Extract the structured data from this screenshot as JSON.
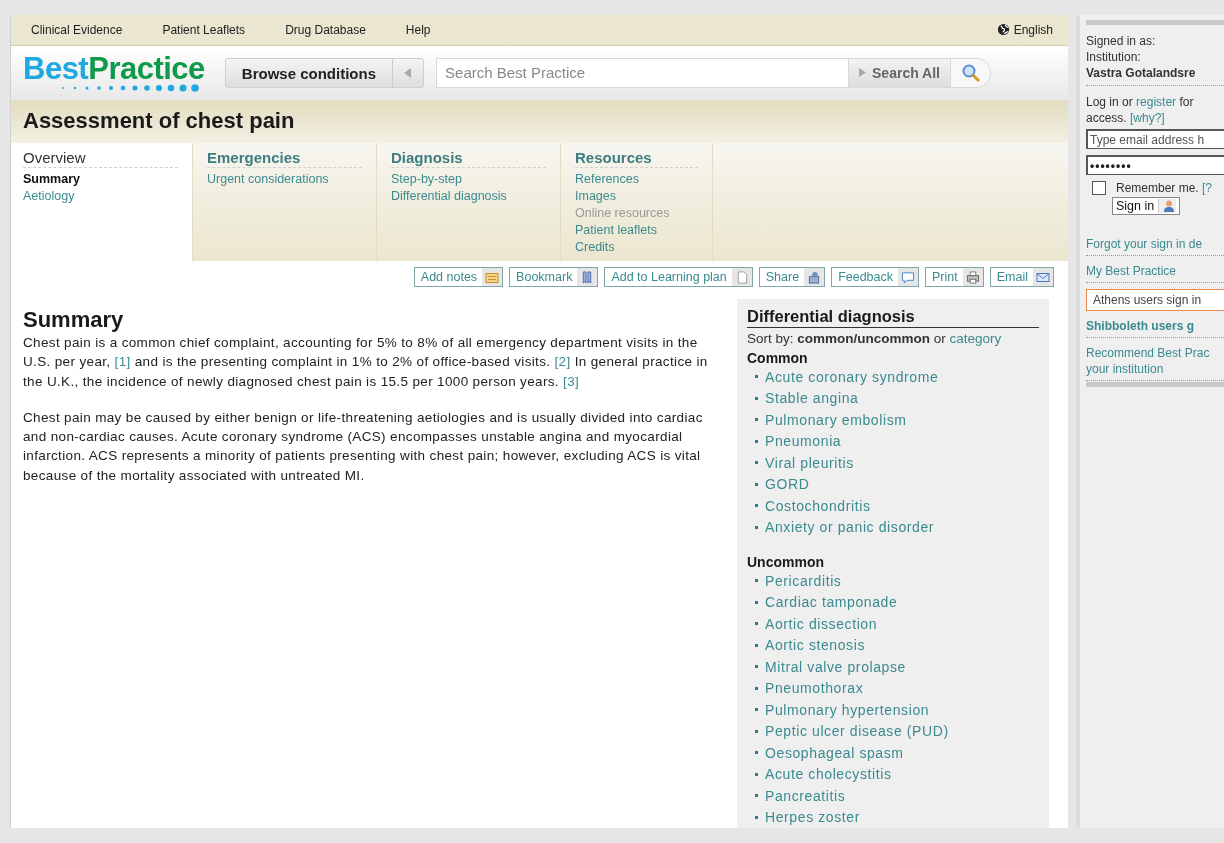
{
  "top_nav": {
    "links": [
      "Clinical Evidence",
      "Patient Leaflets",
      "Drug Database",
      "Help"
    ],
    "language": "English"
  },
  "header": {
    "logo": {
      "first": "Best",
      "second": "Practice"
    },
    "browse_button": "Browse conditions",
    "search": {
      "placeholder": "Search Best Practice"
    },
    "search_all_button": "Search All"
  },
  "page_title": "Assessment of chest pain",
  "tabs": [
    {
      "title": "Overview",
      "selected": true,
      "items": [
        {
          "label": "Summary",
          "selected": true,
          "disabled": false
        },
        {
          "label": "Aetiology",
          "selected": false,
          "disabled": false
        }
      ]
    },
    {
      "title": "Emergencies",
      "selected": false,
      "items": [
        {
          "label": "Urgent considerations",
          "selected": false,
          "disabled": false
        }
      ]
    },
    {
      "title": "Diagnosis",
      "selected": false,
      "items": [
        {
          "label": "Step-by-step",
          "selected": false,
          "disabled": false
        },
        {
          "label": "Differential diagnosis",
          "selected": false,
          "disabled": false
        }
      ]
    },
    {
      "title": "Resources",
      "selected": false,
      "items": [
        {
          "label": "References",
          "selected": false,
          "disabled": false
        },
        {
          "label": "Images",
          "selected": false,
          "disabled": false
        },
        {
          "label": "Online resources",
          "selected": false,
          "disabled": true
        },
        {
          "label": "Patient leaflets",
          "selected": false,
          "disabled": false
        },
        {
          "label": "Credits",
          "selected": false,
          "disabled": false
        }
      ]
    }
  ],
  "actions": [
    {
      "label": "Add notes",
      "kind": "notes"
    },
    {
      "label": "Bookmark",
      "kind": "bookmark"
    },
    {
      "label": "Add to Learning plan",
      "kind": "plan"
    },
    {
      "label": "Share",
      "kind": "share"
    },
    {
      "label": "Feedback",
      "kind": "feedback"
    },
    {
      "label": "Print",
      "kind": "print"
    },
    {
      "label": "Email",
      "kind": "email"
    }
  ],
  "summary": {
    "heading": "Summary",
    "paragraphs": [
      [
        {
          "kind": "text",
          "text": "Chest pain is a common chief complaint, accounting for 5% to 8% of all emergency department visits in the U.S. per year, "
        },
        {
          "kind": "ref",
          "text": "[1]"
        },
        {
          "kind": "text",
          "text": " and is the presenting complaint in 1% to 2% of office-based visits. "
        },
        {
          "kind": "ref",
          "text": "[2]"
        },
        {
          "kind": "text",
          "text": " In general practice in the U.K., the incidence of newly diagnosed chest pain is 15.5 per 1000 person years. "
        },
        {
          "kind": "ref",
          "text": "[3]"
        }
      ],
      [
        {
          "kind": "text",
          "text": "Chest pain may be caused by either benign or life-threatening aetiologies and is usually divided into cardiac and non-cardiac causes. Acute coronary syndrome (ACS) encompasses unstable angina and myocardial infarction. ACS represents a minority of patients presenting with chest pain; however, excluding ACS is vital because of the mortality associated with untreated MI."
        }
      ]
    ]
  },
  "differential": {
    "title": "Differential diagnosis",
    "sort_line": [
      {
        "kind": "text",
        "text": "Sort by: "
      },
      {
        "kind": "bold",
        "text": "common/uncommon"
      },
      {
        "kind": "text",
        "text": " or "
      },
      {
        "kind": "link",
        "text": "category"
      }
    ],
    "groups": [
      {
        "title": "Common",
        "items": [
          "Acute coronary syndrome",
          "Stable angina",
          "Pulmonary embolism",
          "Pneumonia",
          "Viral pleuritis",
          "GORD",
          "Costochondritis",
          "Anxiety or panic disorder"
        ]
      },
      {
        "title": "Uncommon",
        "items": [
          "Pericarditis",
          "Cardiac tamponade",
          "Aortic dissection",
          "Aortic stenosis",
          "Mitral valve prolapse",
          "Pneumothorax",
          "Pulmonary hypertension",
          "Peptic ulcer disease (PUD)",
          "Oesophageal spasm",
          "Acute cholecystitis",
          "Pancreatitis",
          "Herpes zoster"
        ]
      }
    ]
  },
  "sidebar": {
    "signed_in_label": "Signed in as:",
    "institution_label": "Institution:",
    "institution": "Vastra Gotalandsre",
    "login_lines": [
      [
        {
          "kind": "text",
          "text": "Log in or "
        },
        {
          "kind": "link",
          "text": "register"
        },
        {
          "kind": "text",
          "text": " for"
        }
      ],
      [
        {
          "kind": "text",
          "text": "access. "
        },
        {
          "kind": "link",
          "text": "[why?]"
        }
      ]
    ],
    "email": {
      "placeholder": "Type email address h"
    },
    "password": {
      "value": "••••••••"
    },
    "remember": {
      "label": "Remember me.",
      "help": "[?",
      "checked": false
    },
    "sign_in_button": "Sign in",
    "links": [
      {
        "kind": "plain",
        "lines": [
          "Forgot your sign in de"
        ]
      },
      {
        "kind": "plain",
        "lines": [
          "My Best Practice"
        ]
      },
      {
        "kind": "boxed",
        "lines": [
          "Athens users sign in"
        ]
      },
      {
        "kind": "bold",
        "lines": [
          "Shibboleth users g"
        ]
      },
      {
        "kind": "plain",
        "lines": [
          "Recommend Best Prac",
          "your institution"
        ]
      }
    ]
  }
}
